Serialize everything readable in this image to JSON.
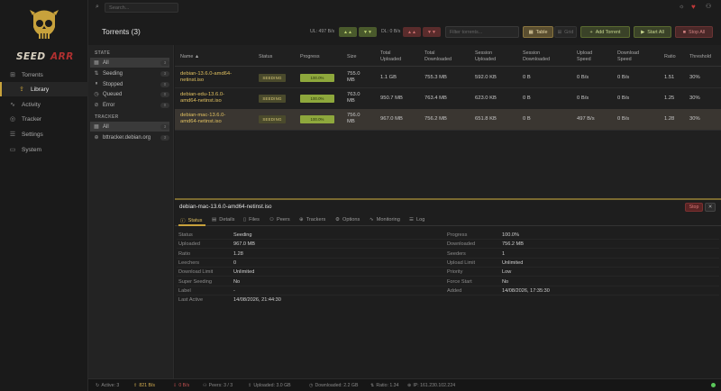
{
  "brand": "SEEDARR",
  "search": {
    "placeholder": "Search..."
  },
  "nav": [
    {
      "icon": "plus-square-icon",
      "label": "Torrents"
    },
    {
      "icon": "upload-icon",
      "label": "Library"
    },
    {
      "icon": "activity-icon",
      "label": "Activity"
    },
    {
      "icon": "radar-icon",
      "label": "Tracker"
    },
    {
      "icon": "sliders-icon",
      "label": "Settings"
    },
    {
      "icon": "monitor-icon",
      "label": "System"
    }
  ],
  "header": {
    "title": "Torrents (3)",
    "ul_label": "UL: 497 B/s",
    "dl_label": "DL: 0 B/s",
    "ul_btn1": "▲▲",
    "ul_btn2": "▼▼",
    "dl_btn1": "▲▲",
    "dl_btn2": "▼▼",
    "filter_placeholder": "Filter torrents...",
    "table_btn": "Table",
    "grid_btn": "Grid",
    "add_btn": "Add Torrent",
    "start_btn": "Start All",
    "stop_btn": "Stop All"
  },
  "filters": {
    "state_heading": "STATE",
    "state_items": [
      {
        "label": "All",
        "count": "3"
      },
      {
        "label": "Seeding",
        "count": "3"
      },
      {
        "label": "Stopped",
        "count": "0"
      },
      {
        "label": "Queued",
        "count": "0"
      },
      {
        "label": "Error",
        "count": "0"
      }
    ],
    "tracker_heading": "TRACKER",
    "tracker_items": [
      {
        "label": "All",
        "count": "3"
      },
      {
        "label": "bttracker.debian.org",
        "count": "3"
      }
    ]
  },
  "table": {
    "columns": [
      "Name ▲",
      "Status",
      "Progress",
      "Size",
      "Total\nUploaded",
      "Total\nDownloaded",
      "Session\nUploaded",
      "Session\nDownloaded",
      "Upload\nSpeed",
      "Download\nSpeed",
      "Ratio",
      "Threshold"
    ],
    "rows": [
      {
        "name": "debian-13.6.0-amd64-\nnetinst.iso",
        "status": "SEEDING",
        "progress": 100,
        "progress_text": "100.0%",
        "size": "755.0\nMB",
        "total_up": "1.1 GB",
        "total_down": "755.3 MB",
        "sess_up": "592.0 KB",
        "sess_down": "0 B",
        "up_speed": "0 B/s",
        "down_speed": "0 B/s",
        "ratio": "1.51",
        "threshold": "30%"
      },
      {
        "name": "debian-edu-13.6.0-\namd64-netinst.iso",
        "status": "SEEDING",
        "progress": 100,
        "progress_text": "100.0%",
        "size": "763.0\nMB",
        "total_up": "950.7 MB",
        "total_down": "763.4 MB",
        "sess_up": "623.0 KB",
        "sess_down": "0 B",
        "up_speed": "0 B/s",
        "down_speed": "0 B/s",
        "ratio": "1.25",
        "threshold": "30%"
      },
      {
        "name": "debian-mac-13.6.0-\namd64-netinst.iso",
        "status": "SEEDING",
        "progress": 100,
        "progress_text": "100.0%",
        "size": "756.0\nMB",
        "total_up": "967.0 MB",
        "total_down": "756.2 MB",
        "sess_up": "651.8 KB",
        "sess_down": "0 B",
        "up_speed": "497 B/s",
        "down_speed": "0 B/s",
        "ratio": "1.28",
        "threshold": "30%"
      }
    ]
  },
  "details": {
    "title": "debian-mac-13.6.0-amd64-netinst.iso",
    "stop_btn": "Stop",
    "close_btn": "✕",
    "tabs": [
      {
        "icon": "info-icon",
        "label": "Status"
      },
      {
        "icon": "document-icon",
        "label": "Details"
      },
      {
        "icon": "file-icon",
        "label": "Files"
      },
      {
        "icon": "users-icon",
        "label": "Peers"
      },
      {
        "icon": "globe-icon",
        "label": "Trackers"
      },
      {
        "icon": "options-icon",
        "label": "Options"
      },
      {
        "icon": "chart-icon",
        "label": "Monitoring"
      },
      {
        "icon": "log-icon",
        "label": "Log"
      }
    ],
    "left": [
      {
        "label": "Status",
        "value": "Seeding"
      },
      {
        "label": "Uploaded",
        "value": "967.0 MB"
      },
      {
        "label": "Ratio",
        "value": "1.28"
      },
      {
        "label": "Leechers",
        "value": "0"
      },
      {
        "label": "Download Limit",
        "value": "Unlimited"
      },
      {
        "label": "Super Seeding",
        "value": "No"
      },
      {
        "label": "Label",
        "value": "-"
      },
      {
        "label": "Last Active",
        "value": "14/08/2026, 21:44:30"
      }
    ],
    "right": [
      {
        "label": "Progress",
        "value": "100.0%"
      },
      {
        "label": "Downloaded",
        "value": "756.2 MB"
      },
      {
        "label": "Seeders",
        "value": "1"
      },
      {
        "label": "Upload Limit",
        "value": "Unlimited"
      },
      {
        "label": "Priority",
        "value": "Low"
      },
      {
        "label": "Force Start",
        "value": "No"
      },
      {
        "label": "Added",
        "value": "14/08/2026, 17:35:30"
      }
    ]
  },
  "statusbar": {
    "active": "Active: 3",
    "up_speed": "821 B/s",
    "down_speed": "0 B/s",
    "peers": "Peers: 3 / 3",
    "uploaded": "Uploaded: 3.0 GB",
    "downloaded": "Downloaded: 2.2 GB",
    "ratio": "Ratio: 1.34",
    "ip": "IP: 161.230.102.224"
  },
  "colors": {
    "accent": "#c8a23c",
    "seeding": "#8ea83c",
    "danger": "#b04040"
  }
}
